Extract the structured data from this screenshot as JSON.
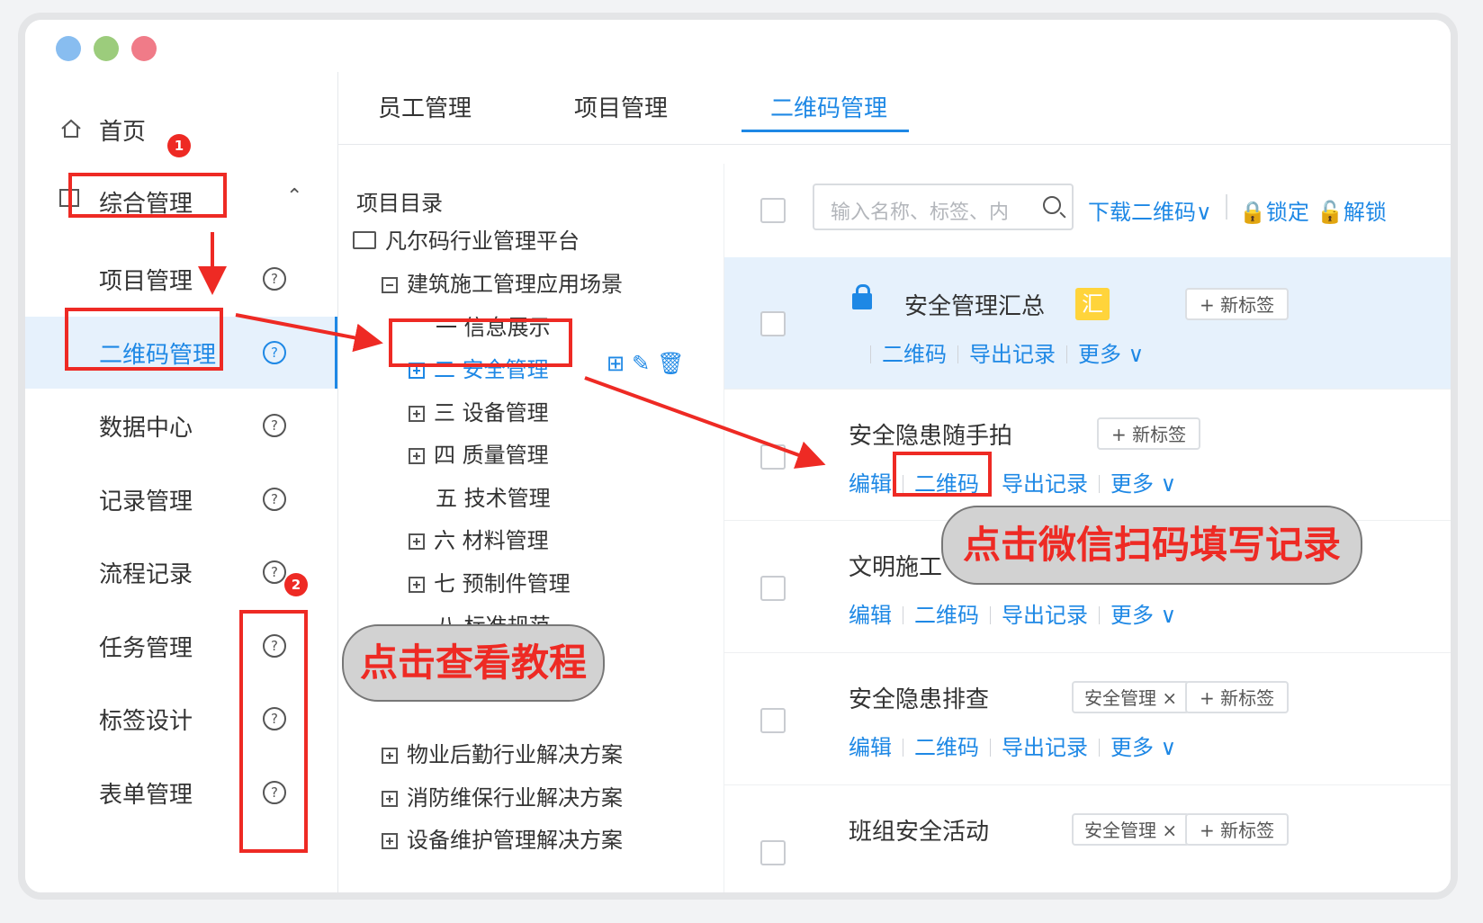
{
  "sidebar": {
    "home": "首页",
    "group": "综合管理",
    "items": [
      {
        "label": "项目管理"
      },
      {
        "label": "二维码管理"
      },
      {
        "label": "数据中心"
      },
      {
        "label": "记录管理"
      },
      {
        "label": "流程记录"
      },
      {
        "label": "任务管理"
      },
      {
        "label": "标签设计"
      },
      {
        "label": "表单管理"
      }
    ],
    "help_glyph": "?"
  },
  "tabs": [
    "员工管理",
    "项目管理",
    "二维码管理"
  ],
  "tree": {
    "title": "项目目录",
    "root": "凡尔码行业管理平台",
    "scene": "建筑施工管理应用场景",
    "nodes": [
      "一 信息展示",
      "二 安全管理",
      "三 设备管理",
      "四 质量管理",
      "五 技术管理",
      "六 材料管理",
      "七 预制件管理",
      "八 标准规范"
    ],
    "solutions": [
      "物业后勤行业解决方案",
      "消防维保行业解决方案",
      "设备维护管理解决方案"
    ],
    "actions": "⊞✎🗑"
  },
  "toolbar": {
    "search_placeholder": "输入名称、标签、内",
    "download": "下载二维码∨",
    "lock": "锁定",
    "unlock": "解锁"
  },
  "items": [
    {
      "title": "安全管理汇总",
      "badge": "汇",
      "new_tag": "+ 新标签",
      "links": [
        "二维码",
        "导出记录",
        "更多 ∨"
      ]
    },
    {
      "title": "安全隐患随手拍",
      "new_tag": "+ 新标签",
      "links": [
        "编辑",
        "二维码",
        "导出记录",
        "更多 ∨"
      ]
    },
    {
      "title": "文明施工",
      "links": [
        "编辑",
        "二维码",
        "导出记录",
        "更多 ∨"
      ]
    },
    {
      "title": "安全隐患排查",
      "tag": "安全管理 ×",
      "new_tag": "+ 新标签",
      "links": [
        "编辑",
        "二维码",
        "导出记录",
        "更多 ∨"
      ]
    },
    {
      "title": "班组安全活动",
      "tag": "安全管理 ×",
      "new_tag": "+ 新标签"
    }
  ],
  "annotations": {
    "badge1": "1",
    "badge2": "2",
    "callout_tutorial": "点击查看教程",
    "callout_wechat": "点击微信扫码填写记录"
  },
  "colors": {
    "accent": "#1e88e5",
    "annotation": "#ee2a24",
    "dot_blue": "#88bdf0",
    "dot_green": "#9ccc7c",
    "dot_red": "#f07b88"
  }
}
